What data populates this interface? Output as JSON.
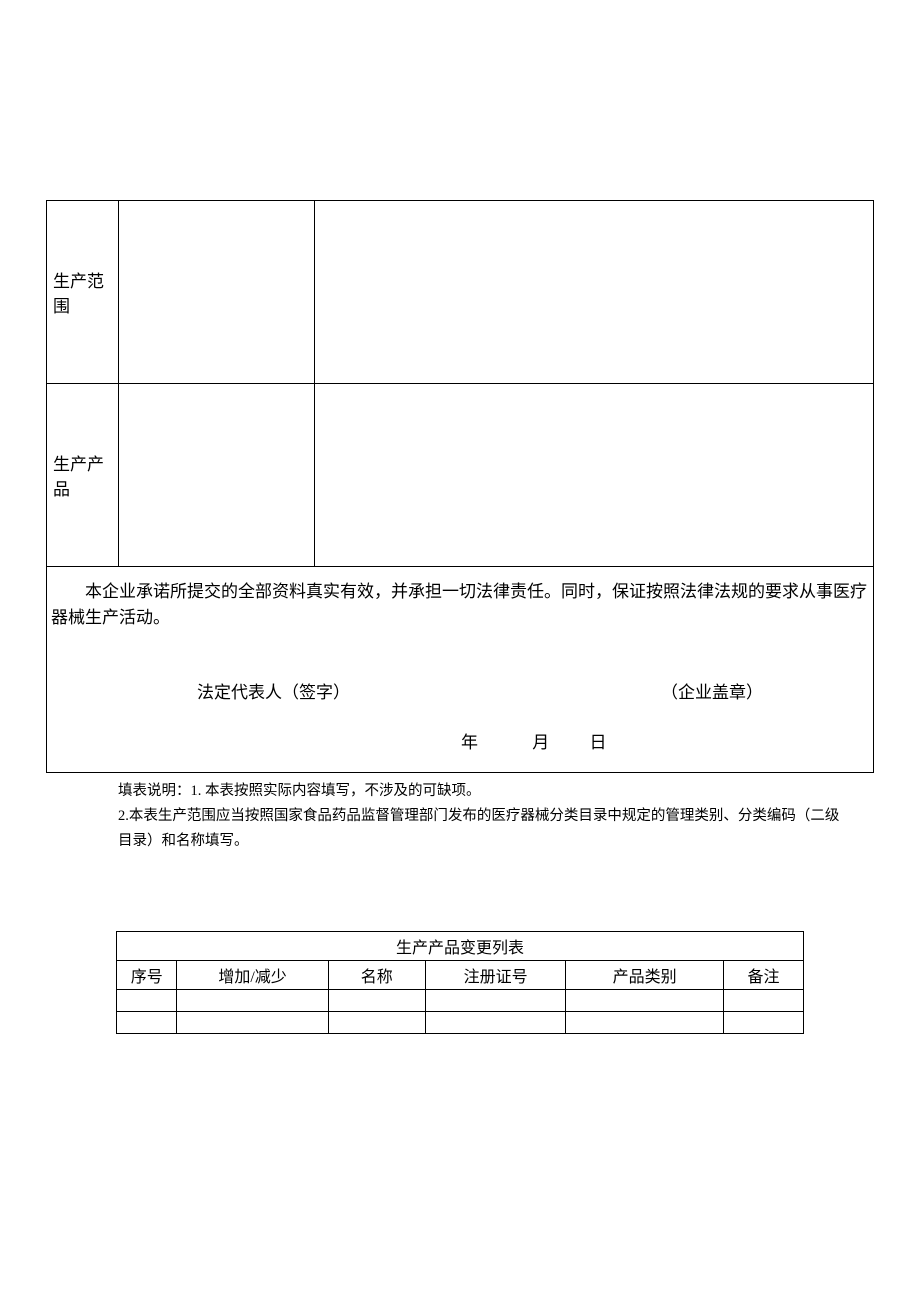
{
  "main": {
    "row1_label": "生产范围",
    "row2_label": "生产产品",
    "declaration_text": "本企业承诺所提交的全部资料真实有效，并承担一切法律责任。同时，保证按照法律法规的要求从事医疗器械生产活动。",
    "sign_rep": "法定代表人（签字）",
    "sign_stamp": "（企业盖章）",
    "date_year": "年",
    "date_month": "月",
    "date_day": "日"
  },
  "notes": {
    "line1": "填表说明：1. 本表按照实际内容填写，不涉及的可缺项。",
    "line2": "2.本表生产范围应当按照国家食品药品监督管理部门发布的医疗器械分类目录中规定的管理类别、分类编码（二级目录）和名称填写。"
  },
  "subtable": {
    "title": "生产产品变更列表",
    "headers": {
      "seq": "序号",
      "change": "增加/减少",
      "name": "名称",
      "regno": "注册证号",
      "category": "产品类别",
      "remark": "备注"
    },
    "rows": [
      {
        "seq": "",
        "change": "",
        "name": "",
        "regno": "",
        "category": "",
        "remark": ""
      },
      {
        "seq": "",
        "change": "",
        "name": "",
        "regno": "",
        "category": "",
        "remark": ""
      }
    ]
  }
}
